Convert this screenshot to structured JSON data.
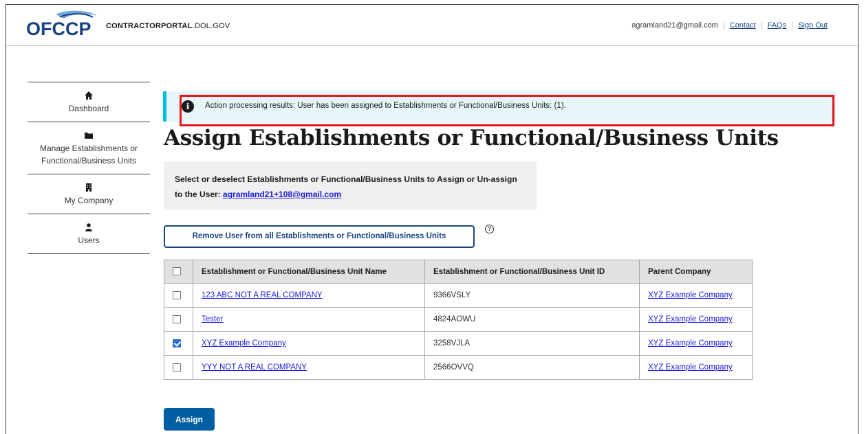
{
  "header": {
    "logo_text": "OFCCP",
    "site_name_bold": "CONTRACTORPORTAL",
    "site_name_rest": ".DOL.GOV",
    "user_email": "agramland21@gmail.com",
    "links": [
      "Contact",
      "FAQs",
      "Sign Out"
    ]
  },
  "sidebar": {
    "items": [
      {
        "label": "Dashboard",
        "icon": "home-icon"
      },
      {
        "label": "Manage Establishments or Functional/Business Units",
        "icon": "folder-icon"
      },
      {
        "label": "My Company",
        "icon": "building-icon"
      },
      {
        "label": "Users",
        "icon": "user-icon"
      }
    ]
  },
  "alert": {
    "icon": "info-icon",
    "text": "Action processing results: User has been assigned to Establishments or Functional/Business Units: (1)."
  },
  "main": {
    "title": "Assign Establishments or Functional/Business Units",
    "instruction_text": "Select or deselect Establishments or Functional/Business Units to Assign or Un-assign to the User: ",
    "instruction_email": "agramland21+108@gmail.com",
    "remove_button": "Remove User from all Establishments or Functional/Business Units",
    "help_icon": "help-icon",
    "assign_button": "Assign"
  },
  "table": {
    "headers": [
      "Establishment or Functional/Business Unit Name",
      "Establishment or Functional/Business Unit ID",
      "Parent Company"
    ],
    "rows": [
      {
        "checked": false,
        "name": "123 ABC NOT A REAL COMPANY",
        "id": "9366VSLY",
        "parent": "XYZ Example Company"
      },
      {
        "checked": false,
        "name": "Tester",
        "id": "4824AOWU",
        "parent": "XYZ Example Company"
      },
      {
        "checked": true,
        "name": "XYZ Example Company",
        "id": "3258VJLA",
        "parent": "XYZ Example Company"
      },
      {
        "checked": false,
        "name": "YYY NOT A REAL COMPANY",
        "id": "2566OVVQ",
        "parent": "XYZ Example Company"
      }
    ]
  },
  "colors": {
    "alert_bg": "#e7f6f8",
    "alert_border": "#00bde3",
    "highlight": "#e8141b",
    "primary": "#005ea2",
    "link": "#1a1add"
  }
}
